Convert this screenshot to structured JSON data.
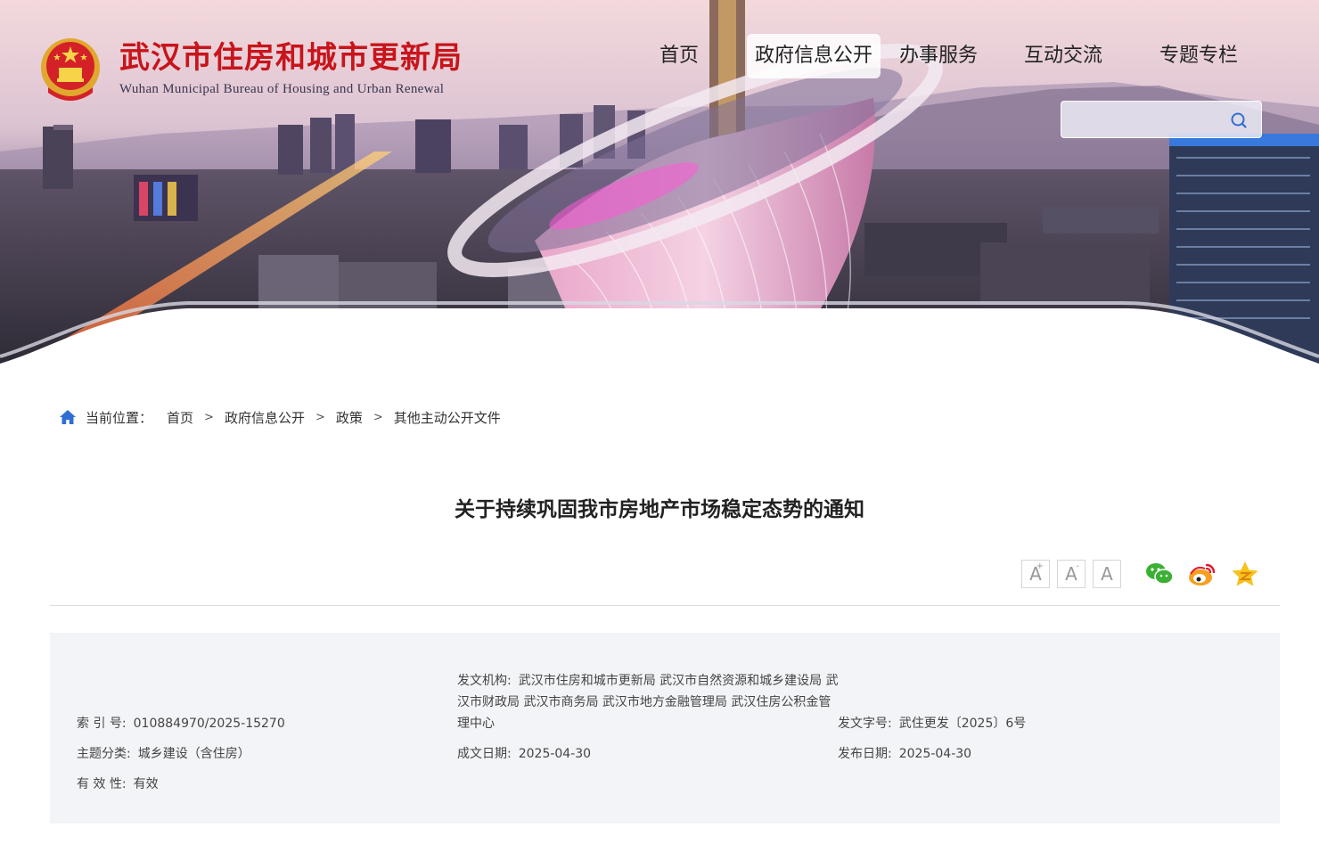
{
  "header": {
    "title_cn": "武汉市住房和城市更新局",
    "title_en": "Wuhan Municipal Bureau of Housing and Urban Renewal",
    "nav": [
      "首页",
      "政府信息公开",
      "办事服务",
      "互动交流",
      "专题专栏"
    ],
    "active_nav": "政府信息公开",
    "search": {
      "placeholder": "",
      "icon": "search-icon"
    }
  },
  "breadcrumb": {
    "label": "当前位置：",
    "items": [
      "首页",
      "政府信息公开",
      "政策",
      "其他主动公开文件"
    ],
    "separator": ">"
  },
  "article": {
    "title": "关于持续巩固我市房地产市场稳定态势的通知",
    "font_tools": [
      "A+",
      "A-",
      "A"
    ],
    "share_icons": [
      "wechat-icon",
      "weibo-icon",
      "qzone-icon"
    ]
  },
  "meta": {
    "index_label": "索 引 号:",
    "index_value": "010884970/2025-15270",
    "issuer_label": "发文机构:",
    "issuer_value": "武汉市住房和城市更新局 武汉市自然资源和城乡建设局 武汉市财政局 武汉市商务局 武汉市地方金融管理局 武汉住房公积金管理中心",
    "doc_no_label": "发文字号:",
    "doc_no_value": "武住更发〔2025〕6号",
    "topic_label": "主题分类:",
    "topic_value": "城乡建设（含住房）",
    "created_label": "成文日期:",
    "created_value": "2025-04-30",
    "published_label": "发布日期:",
    "published_value": "2025-04-30",
    "validity_label": "有 效 性:",
    "validity_value": "有效"
  },
  "colors": {
    "brand_red": "#c8141b",
    "accent_blue": "#2f6fd1",
    "meta_bg": "#f3f4f7"
  }
}
